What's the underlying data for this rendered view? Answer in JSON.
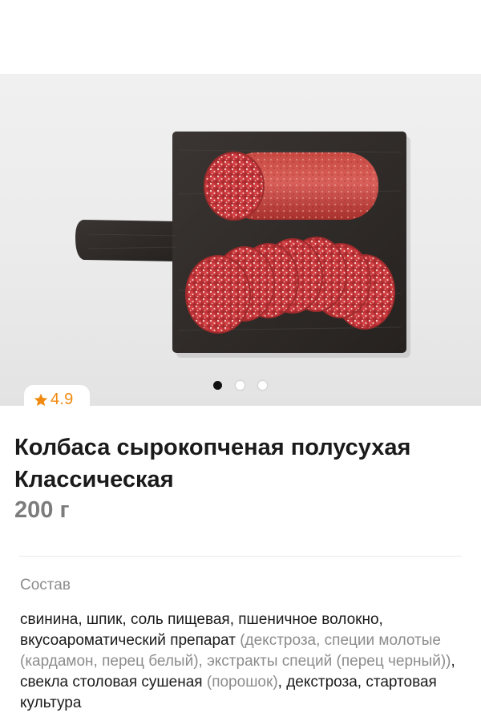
{
  "gallery": {
    "image_description_icon": "salami-on-board-photo",
    "slide_count": 3,
    "active_slide": 1
  },
  "rating": {
    "icon": "star-icon",
    "value": "4.9",
    "color": "#f08a10"
  },
  "product": {
    "title": "Колбаса сырокопченая полусухая Классическая",
    "weight": "200 г"
  },
  "composition": {
    "label": "Состав",
    "part1": "свинина, шпик, соль пищевая, пшеничное волокно, вкусоароматический препарат ",
    "part2": "(декстроза, специи молотые  (кардамон, перец белый), экстракты специй (перец черный))",
    "part3": ", свекла столовая сушеная ",
    "part4": "(порошок)",
    "part5": ", декстроза, стартовая культура"
  }
}
